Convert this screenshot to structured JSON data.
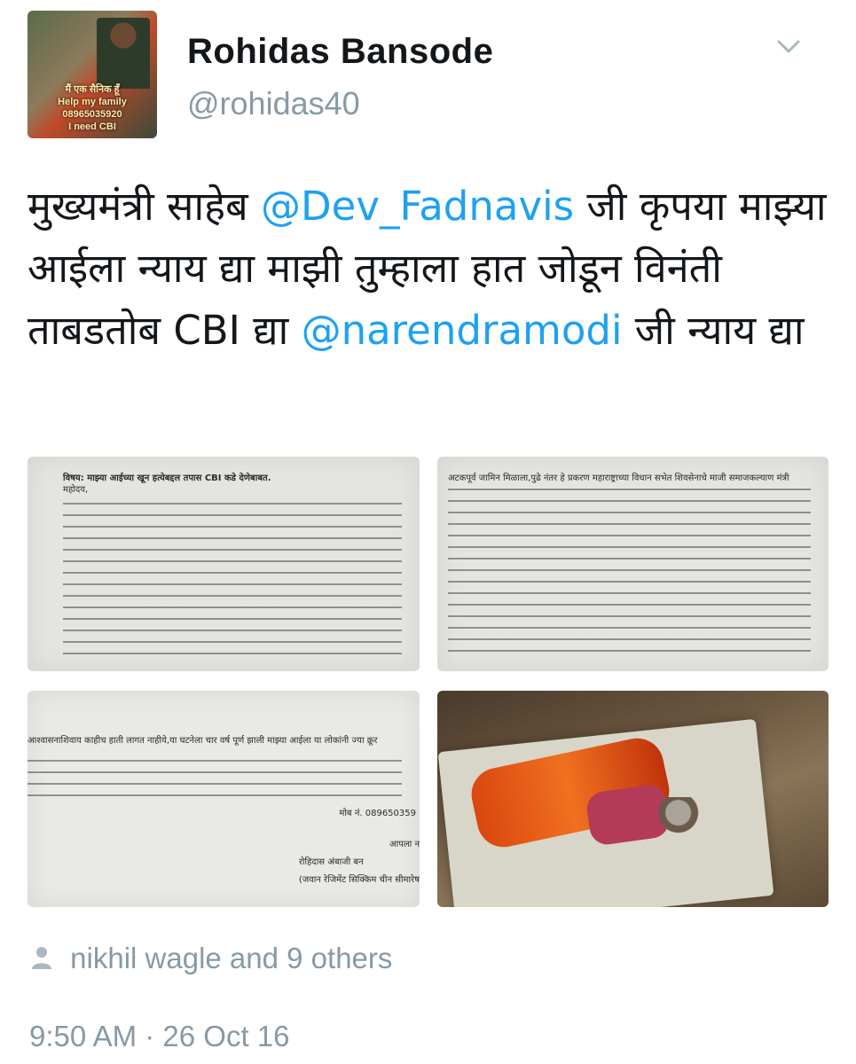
{
  "author": {
    "display_name": "Rohidas Bansode",
    "handle": "@rohidas40",
    "avatar_caption": [
      "मैं एक सैनिक हूँ",
      "Help my family 08965035920",
      "I need CBI"
    ]
  },
  "tweet": {
    "text_parts": [
      {
        "text": "मुख्यमंत्री साहेब ",
        "type": "text"
      },
      {
        "text": "@Dev_Fadnavis",
        "type": "mention"
      },
      {
        "text": " जी कृपया माझ्या आईला न्याय द्या माझी तुम्हाला हात जोडून विनंती ताबडतोब CBI द्या ",
        "type": "text"
      },
      {
        "text": "@narendramodi",
        "type": "mention"
      },
      {
        "text": " जी न्याय द्या",
        "type": "text"
      }
    ]
  },
  "media": {
    "doc1_heading": "विषय: माझ्या आईच्या खून हत्येबद्दल तपास CBI कडे देणेबाबत.",
    "doc1_salutation": "महोदय,",
    "doc2_text": "अटकपूर्व जामिन मिळाला,पुढे नंतर हे प्रकरण महाराष्ट्राच्या विधान सभेत शिवसेनाचे माजी समाजकल्याण मंत्री",
    "doc3_text": "आश्वासनाशिवाय काहीच हाती लागत नाहीये,या घटनेला चार वर्ष पूर्ण झाली माझ्या आईला या लोकांनी ज्या क्रूर",
    "doc3_phone_label": "मोब नं.",
    "doc3_phone": "089650359",
    "doc3_signoff": "आपला न",
    "doc3_signer": "रोहिदास अंबाजी बन",
    "doc3_regiment": "(जवान रेजिमेंट सिक्किम चीन सीमारेष"
  },
  "likes": {
    "text": "nikhil wagle and 9 others"
  },
  "timestamp": {
    "text": "9:50 AM · 26 Oct 16"
  },
  "colors": {
    "mention": "#1da1f2",
    "muted": "#8899a6",
    "text": "#14171a"
  }
}
